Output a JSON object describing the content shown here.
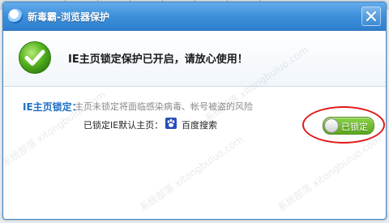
{
  "window": {
    "title": "新毒霸-浏览器保护"
  },
  "banner": {
    "message": "IE主页锁定保护已开启，请放心使用！"
  },
  "homepage_lock": {
    "label": "IE主页锁定：",
    "description": "主页未锁定将面临感染病毒、帐号被盗的风险",
    "locked_label": "已锁定IE默认主页：",
    "locked_homepage": "百度搜索",
    "toggle_label": "已锁定",
    "toggle_on": true
  },
  "watermark": {
    "text": "系统部落 xitongbuluo.com"
  },
  "colors": {
    "title_bar": "#3d8fd9",
    "accent_blue": "#1f6fc5",
    "toggle_green": "#6dbb2b",
    "highlight_red": "#e01818"
  },
  "icons": [
    "shield-logo-icon",
    "close-icon",
    "checkmark-icon",
    "baidu-paw-icon"
  ]
}
